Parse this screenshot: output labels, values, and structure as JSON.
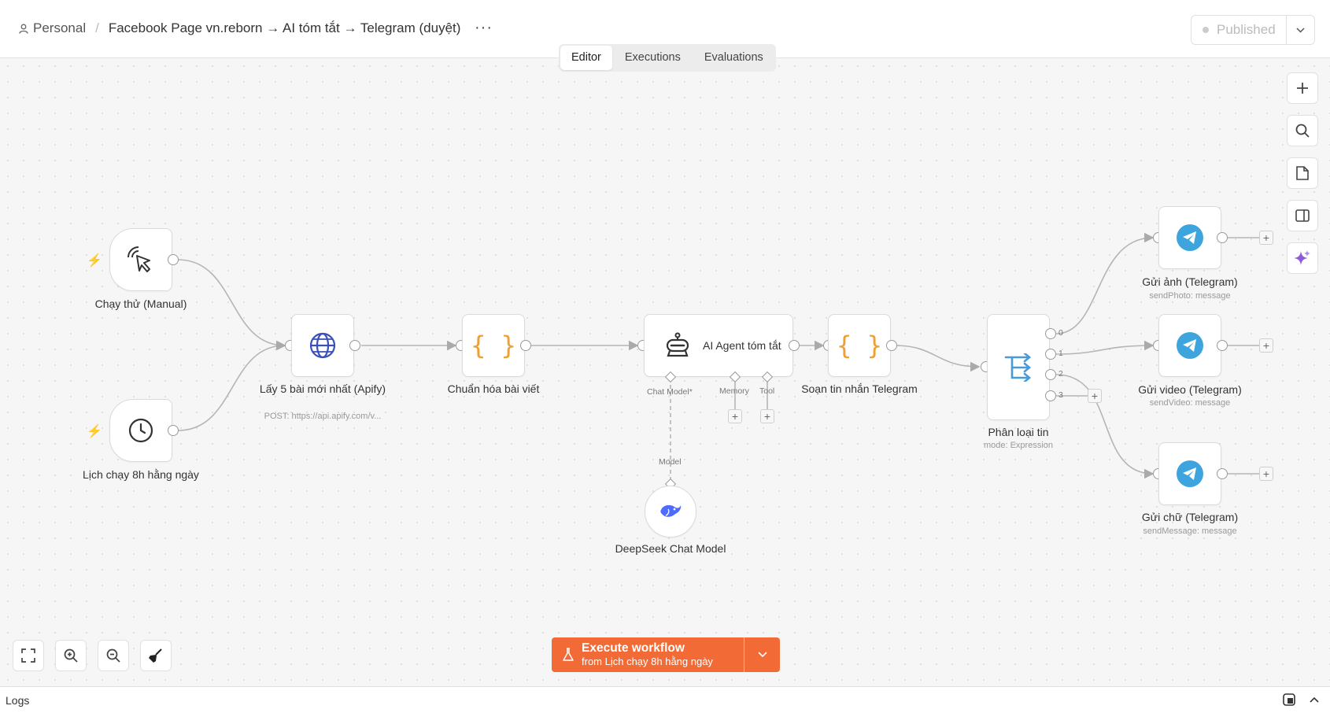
{
  "breadcrumb": {
    "workspace": "Personal",
    "workflow_title": "Facebook Page vn.reborn → AI tóm tắt → Telegram (duyệt)",
    "more": "···"
  },
  "status": {
    "label": "Published"
  },
  "tabs": [
    {
      "label": "Editor",
      "active": true
    },
    {
      "label": "Executions",
      "active": false
    },
    {
      "label": "Evaluations",
      "active": false
    }
  ],
  "nodes": {
    "manual_trigger": {
      "label": "Chạy thử (Manual)",
      "icon": "cursor-click-icon"
    },
    "schedule_trigger": {
      "label": "Lịch chạy 8h hằng ngày",
      "icon": "clock-icon"
    },
    "http_request": {
      "label": "Lấy 5 bài mới nhất (Apify)",
      "sub": "POST: https://api.apify.com/v...",
      "icon": "globe-icon"
    },
    "normalize": {
      "label": "Chuẩn hóa bài viết",
      "icon": "code-braces-icon"
    },
    "ai_agent": {
      "label": "AI Agent tóm tắt",
      "icon": "robot-icon",
      "ports": {
        "chat_model": "Chat Model*",
        "memory": "Memory",
        "tool": "Tool"
      }
    },
    "compose": {
      "label": "Soạn tin nhắn Telegram",
      "icon": "code-braces-icon"
    },
    "switch": {
      "label": "Phân loại tin",
      "sub": "mode: Expression",
      "icon": "switch-icon",
      "outputs": [
        "0",
        "1",
        "2",
        "3"
      ]
    },
    "deepseek": {
      "label": "DeepSeek Chat Model",
      "port_label": "Model",
      "icon": "deepseek-whale-icon"
    },
    "tg_photo": {
      "label": "Gửi ảnh (Telegram)",
      "sub": "sendPhoto: message",
      "icon": "telegram-icon"
    },
    "tg_video": {
      "label": "Gửi video (Telegram)",
      "sub": "sendVideo: message",
      "icon": "telegram-icon"
    },
    "tg_text": {
      "label": "Gửi chữ (Telegram)",
      "sub": "sendMessage: message",
      "icon": "telegram-icon"
    }
  },
  "execute": {
    "title": "Execute workflow",
    "subtitle": "from Lịch chạy 8h hằng ngày"
  },
  "logs": {
    "label": "Logs"
  },
  "colors": {
    "accent": "#f26a35",
    "telegram": "#3da4dd",
    "code": "#f0a030",
    "globe": "#3b4fb8"
  }
}
